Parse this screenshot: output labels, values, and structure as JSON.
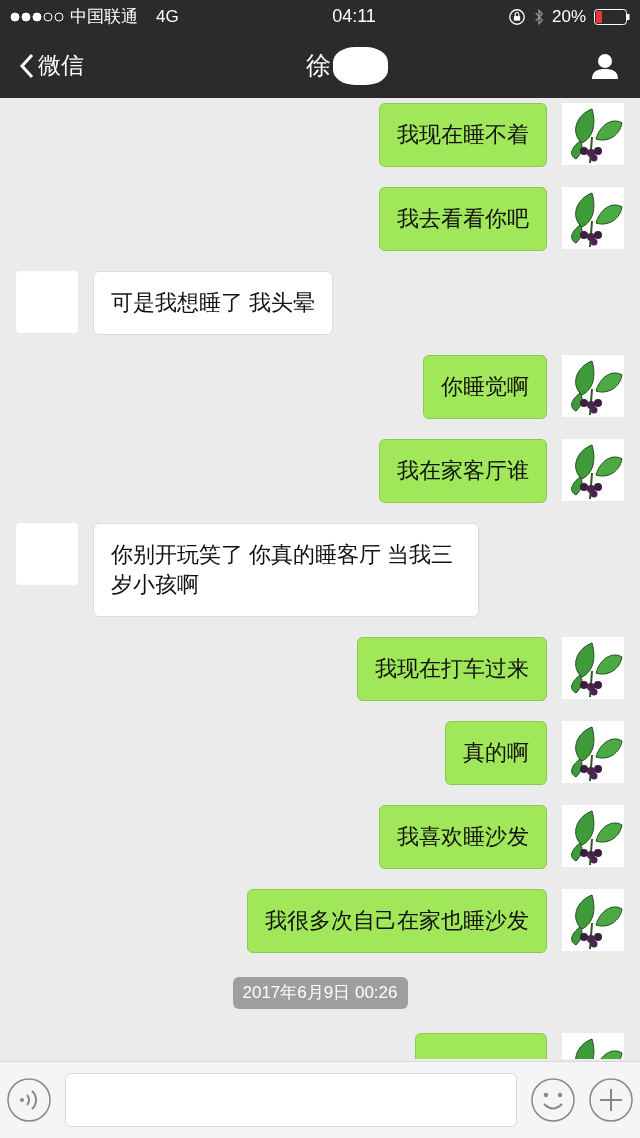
{
  "status_bar": {
    "carrier": "中国联通",
    "network": "4G",
    "time": "04:11",
    "battery": "20%"
  },
  "nav": {
    "back": "微信",
    "title": "徐"
  },
  "messages": [
    {
      "kind": "sent",
      "text": "我现在睡不着"
    },
    {
      "kind": "sent",
      "text": "我去看看你吧"
    },
    {
      "kind": "received",
      "text": "可是我想睡了 我头晕"
    },
    {
      "kind": "sent",
      "text": "你睡觉啊"
    },
    {
      "kind": "sent",
      "text": "我在家客厅谁"
    },
    {
      "kind": "received",
      "text": "你别开玩笑了 你真的睡客厅 当我三岁小孩啊"
    },
    {
      "kind": "sent",
      "text": "我现在打车过来"
    },
    {
      "kind": "sent",
      "text": "真的啊"
    },
    {
      "kind": "sent",
      "text": "我喜欢睡沙发"
    },
    {
      "kind": "sent",
      "text": "我很多次自己在家也睡沙发"
    },
    {
      "kind": "time",
      "text": "2017年6月9日 00:26"
    },
    {
      "kind": "partial"
    }
  ]
}
